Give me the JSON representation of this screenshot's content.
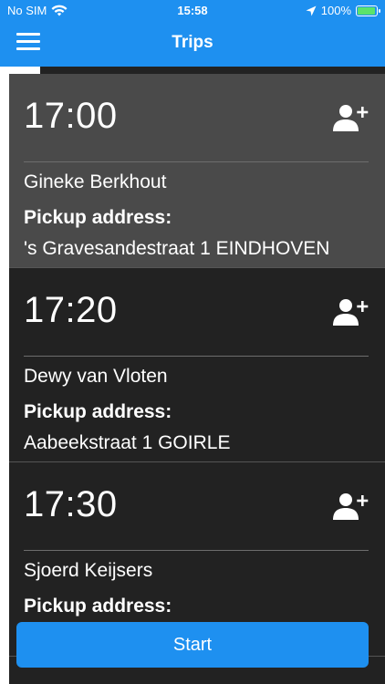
{
  "status_bar": {
    "carrier": "No SIM",
    "time": "15:58",
    "battery": "100%",
    "battery_level": 1.0
  },
  "nav": {
    "title": "Trips",
    "menu_icon": "hamburger-menu-icon"
  },
  "trips": [
    {
      "time": "17:00",
      "passenger": "Gineke Berkhout",
      "pickup_label": "Pickup address:",
      "pickup_address": "'s Gravesandestraat 1 EINDHOVEN",
      "selected": true
    },
    {
      "time": "17:20",
      "passenger": "Dewy van Vloten",
      "pickup_label": "Pickup address:",
      "pickup_address": "Aabeekstraat 1 GOIRLE",
      "selected": false
    },
    {
      "time": "17:30",
      "passenger": "Sjoerd Keijsers",
      "pickup_label": "Pickup address:",
      "pickup_address": "",
      "selected": false
    }
  ],
  "actions": {
    "start_label": "Start"
  },
  "colors": {
    "accent": "#1e90f0",
    "background": "#222222",
    "selected_card": "#4a4a4a",
    "battery": "#5be36b"
  }
}
